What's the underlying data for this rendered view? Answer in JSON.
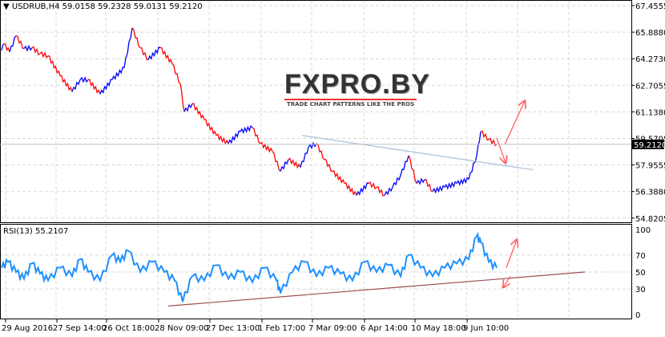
{
  "header": {
    "symbol": "USDRUB,H4",
    "ohlc": "59.0158 59.2328 59.0131 59.2120",
    "menu_icon": "triangle-down-icon"
  },
  "rsi_header": "RSI(13) 55.2107",
  "logo": {
    "text": "FXPRO.BY",
    "tagline": "TRADE CHART PATTERNS LIKE THE PROS"
  },
  "colors": {
    "up": "#0000ff",
    "down": "#ff0000",
    "rsi": "#1e90ff",
    "trend_price": "#b0c4de",
    "trend_rsi": "#a05050",
    "arrow": "#ff6060",
    "grid": "#d8d8d8"
  },
  "chart_data": [
    {
      "type": "line",
      "title": "USDRUB,H4",
      "ylim": [
        54.8205,
        67.4555
      ],
      "yticks": [
        "67.4555",
        "65.8880",
        "64.2730",
        "62.7055",
        "61.1380",
        "59.5705",
        "57.9555",
        "56.3880",
        "54.8205"
      ],
      "current_price": "59.2120",
      "xticks": [
        "29 Aug 2016",
        "27 Sep 14:00",
        "26 Oct 18:00",
        "28 Nov 09:00",
        "27 Dec 13:00",
        "1 Feb 17:00",
        "7 Mar 09:00",
        "6 Apr 14:00",
        "10 May 18:00",
        "9 Jun 10:00"
      ],
      "x": [
        2,
        5,
        12,
        20,
        30,
        40,
        50,
        60,
        75,
        90,
        100,
        110,
        125,
        140,
        155,
        165,
        175,
        185,
        200,
        215,
        225,
        230,
        240,
        255,
        270,
        285,
        300,
        315,
        325,
        340,
        350,
        360,
        375,
        385,
        395,
        405,
        415,
        430,
        445,
        460,
        470,
        480,
        490,
        500,
        510,
        520,
        530,
        540,
        555,
        570,
        585,
        595,
        600,
        610,
        620
      ],
      "values": [
        64.8,
        65.18,
        64.7,
        65.66,
        64.9,
        64.95,
        64.6,
        64.47,
        63.29,
        62.34,
        63.05,
        63.05,
        62.2,
        63.05,
        63.76,
        66.13,
        64.95,
        64.24,
        64.95,
        64.0,
        62.81,
        61.15,
        61.63,
        60.68,
        59.74,
        59.26,
        59.97,
        60.21,
        59.26,
        58.79,
        57.61,
        58.32,
        57.84,
        59.03,
        59.26,
        58.32,
        57.61,
        56.89,
        56.18,
        56.89,
        56.66,
        56.18,
        56.66,
        57.37,
        58.55,
        56.89,
        57.13,
        56.42,
        56.66,
        56.89,
        57.13,
        58.55,
        59.97,
        59.5,
        59.21
      ],
      "trendline": {
        "from": [
          377,
          59.74
        ],
        "to": [
          665,
          57.7
        ]
      },
      "arrows": [
        {
          "from": [
            630,
            59.2
          ],
          "to": [
            655,
            61.8
          ]
        },
        {
          "from": [
            620,
            59.6
          ],
          "to": [
            631,
            58.1
          ]
        }
      ]
    },
    {
      "type": "line",
      "title": "RSI(13) 55.2107",
      "ylim": [
        0,
        100
      ],
      "yticks": [
        "100",
        "70",
        "50",
        "30",
        "0"
      ],
      "x": [
        2,
        10,
        20,
        30,
        40,
        50,
        60,
        75,
        90,
        100,
        110,
        125,
        140,
        150,
        160,
        175,
        190,
        205,
        218,
        228,
        240,
        255,
        270,
        285,
        300,
        315,
        330,
        345,
        350,
        365,
        380,
        395,
        410,
        425,
        440,
        455,
        470,
        485,
        500,
        510,
        525,
        540,
        555,
        570,
        585,
        595,
        600,
        610,
        620
      ],
      "values": [
        55,
        62,
        50,
        42,
        60,
        48,
        40,
        55,
        45,
        65,
        50,
        40,
        70,
        62,
        75,
        50,
        62,
        50,
        40,
        15,
        45,
        40,
        58,
        42,
        50,
        38,
        55,
        40,
        25,
        50,
        62,
        45,
        55,
        48,
        40,
        62,
        50,
        58,
        45,
        70,
        55,
        45,
        55,
        60,
        65,
        92,
        85,
        62,
        55
      ],
      "trendline": {
        "from": [
          210,
          10
        ],
        "to": [
          730,
          50
        ]
      },
      "arrows": [
        {
          "from": [
            632,
            55
          ],
          "to": [
            645,
            88
          ]
        },
        {
          "from": [
            637,
            45
          ],
          "to": [
            628,
            32
          ]
        }
      ]
    }
  ]
}
